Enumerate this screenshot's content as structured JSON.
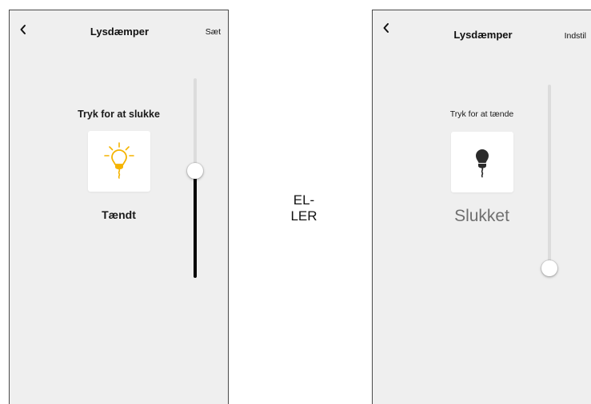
{
  "screens": [
    {
      "header": {
        "back_icon": "chevron-left-icon",
        "title": "Lysdæmper",
        "action_label": "Sæt"
      },
      "hint": "Tryk for at slukke",
      "bulb_icon": "lightbulb-on-icon",
      "bulb_color": "#f5b400",
      "state_label": "Tændt",
      "dimmer_level_percent": 54
    },
    {
      "header": {
        "back_icon": "chevron-left-icon",
        "title": "Lysdæmper",
        "action_label": "Indstil"
      },
      "hint": "Tryk for at tænde",
      "bulb_icon": "lightbulb-off-icon",
      "bulb_color": "#2b2b2b",
      "state_label": "Slukket",
      "dimmer_level_percent": 0
    }
  ],
  "separator": {
    "line1": "EL-",
    "line2": "LER"
  }
}
